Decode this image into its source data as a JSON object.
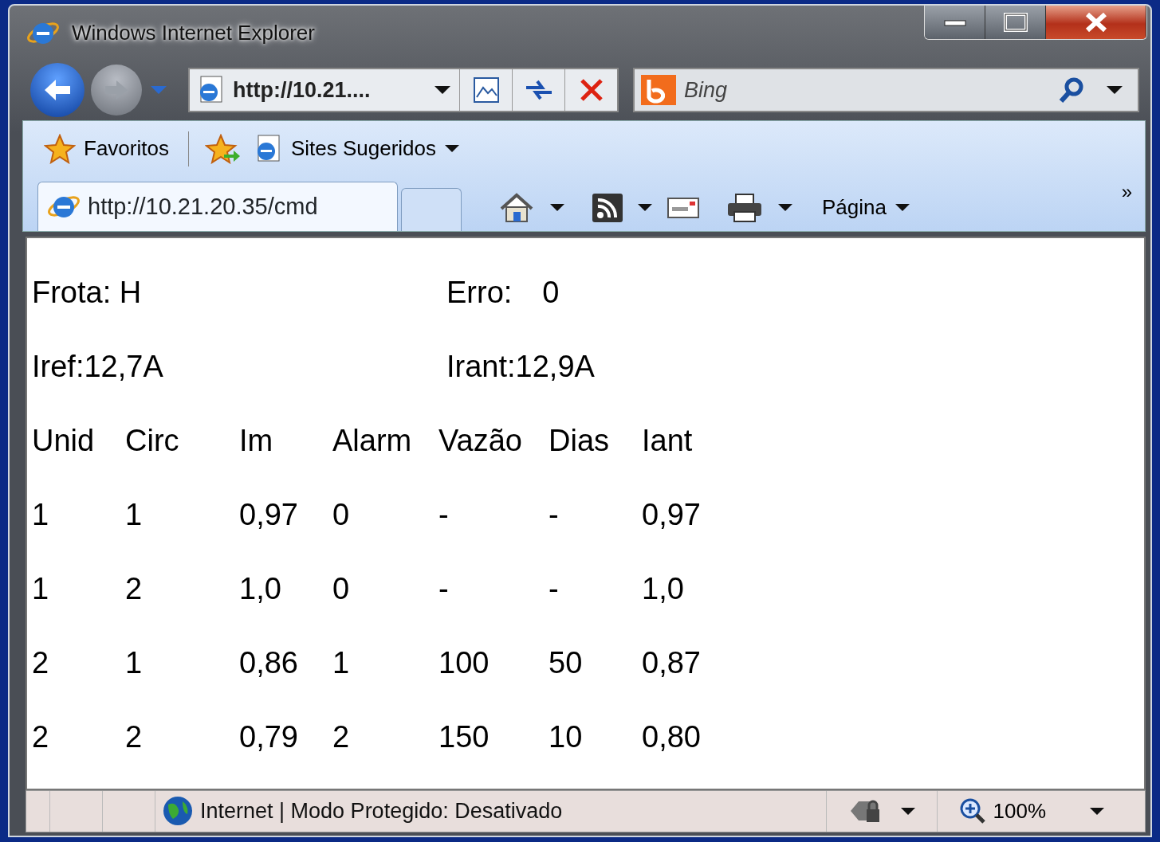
{
  "window": {
    "title": "Windows Internet Explorer"
  },
  "navigation": {
    "address": "http://10.21....",
    "search_placeholder": "Bing"
  },
  "favorites_bar": {
    "favorites": "Favoritos",
    "suggested": "Sites Sugeridos"
  },
  "tabs": [
    {
      "label": "http://10.21.20.35/cmd",
      "selected": true
    }
  ],
  "command_bar": {
    "page_menu": "Página",
    "more": "»"
  },
  "content": {
    "info_rows": [
      [
        {
          "text": "Frota: H"
        },
        {
          "text": "Erro:",
          "value": "0"
        }
      ],
      [
        {
          "text": "Iref:12,7A"
        },
        {
          "text": "Irant:12,9A"
        }
      ]
    ],
    "table": {
      "columns": [
        "Unid",
        "Circ",
        "Im",
        "Alarm",
        "Vazão",
        "Dias",
        "Iant"
      ],
      "rows": [
        [
          "1",
          "1",
          "0,97",
          "0",
          "-",
          "-",
          "0,97"
        ],
        [
          "1",
          "2",
          "1,0",
          "0",
          "-",
          "-",
          "1,0"
        ],
        [
          "2",
          "1",
          "0,86",
          "1",
          "100",
          "50",
          "0,87"
        ],
        [
          "2",
          "2",
          "0,79",
          "2",
          "150",
          "10",
          "0,80"
        ]
      ]
    }
  },
  "status_bar": {
    "zone": "Internet | Modo Protegido: Desativado",
    "zoom": "100%"
  }
}
